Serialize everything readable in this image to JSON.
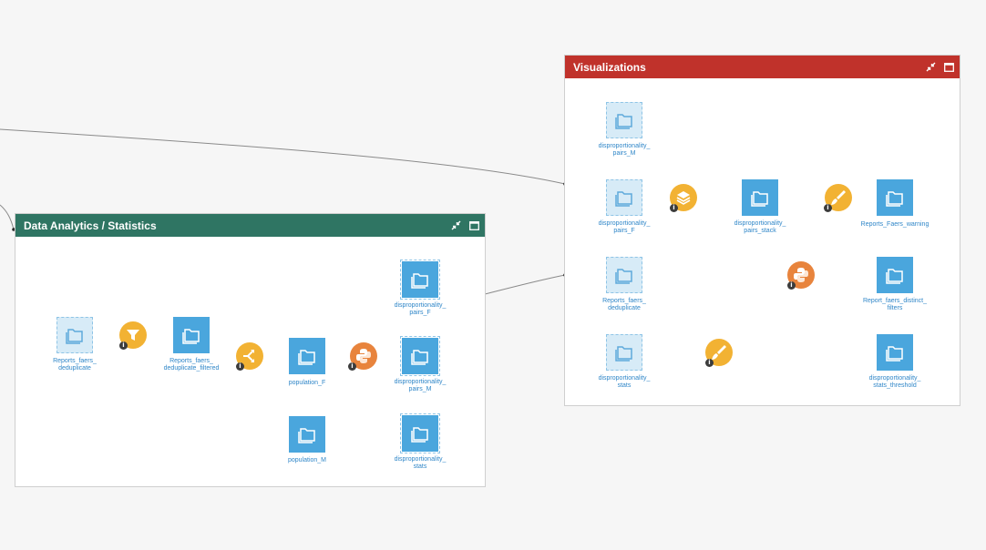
{
  "zones": [
    {
      "id": "visualizations",
      "title": "Visualizations",
      "color": "#c0322b"
    },
    {
      "id": "analytics",
      "title": "Data Analytics / Statistics",
      "color": "#2f7563"
    }
  ],
  "zone_actions": {
    "collapse_icon": "collapse-icon",
    "maximize_icon": "maximize-icon"
  },
  "datasets": {
    "vis_pairs_m": {
      "label": "disproportionality_\npairs_M",
      "kind": "shared"
    },
    "vis_pairs_f": {
      "label": "disproportionality_\npairs_F",
      "kind": "shared"
    },
    "vis_pairs_stack": {
      "label": "disproportionality_\npairs_stack",
      "kind": "managed"
    },
    "vis_faers_warning": {
      "label": "Reports_Faers_warning",
      "kind": "managed"
    },
    "vis_reports_dedup": {
      "label": "Reports_faers_\ndeduplicate",
      "kind": "shared"
    },
    "vis_distinct_filters": {
      "label": "Report_faers_distinct_\nfilters",
      "kind": "managed"
    },
    "vis_stats": {
      "label": "disproportionality_\nstats",
      "kind": "shared"
    },
    "vis_stats_threshold": {
      "label": "disproportionality_\nstats_threshold",
      "kind": "managed"
    },
    "an_reports_dedup": {
      "label": "Reports_faers_\ndeduplicate",
      "kind": "shared"
    },
    "an_dedup_filtered": {
      "label": "Reports_faers_\ndeduplicate_filtered",
      "kind": "managed"
    },
    "an_population_f": {
      "label": "population_F",
      "kind": "managed"
    },
    "an_population_m": {
      "label": "population_M",
      "kind": "managed"
    },
    "an_pairs_f": {
      "label": "disproportionality_\npairs_F",
      "kind": "managed"
    },
    "an_pairs_m": {
      "label": "disproportionality_\npairs_M",
      "kind": "managed"
    },
    "an_stats": {
      "label": "disproportionality_\nstats",
      "kind": "managed"
    }
  },
  "recipes": {
    "vis_stack": {
      "icon": "stack-recipe-icon",
      "color": "#f2b233"
    },
    "vis_prepare_1": {
      "icon": "prepare-brush-icon",
      "color": "#f2b233"
    },
    "vis_python": {
      "icon": "python-recipe-icon",
      "color": "#e8843d"
    },
    "vis_prepare_2": {
      "icon": "prepare-brush-icon",
      "color": "#f2b233"
    },
    "an_filter": {
      "icon": "filter-recipe-icon",
      "color": "#f2b233"
    },
    "an_split": {
      "icon": "split-recipe-icon",
      "color": "#f2b233"
    },
    "an_python": {
      "icon": "python-recipe-icon",
      "color": "#e8843d"
    }
  },
  "info_badge": "i"
}
